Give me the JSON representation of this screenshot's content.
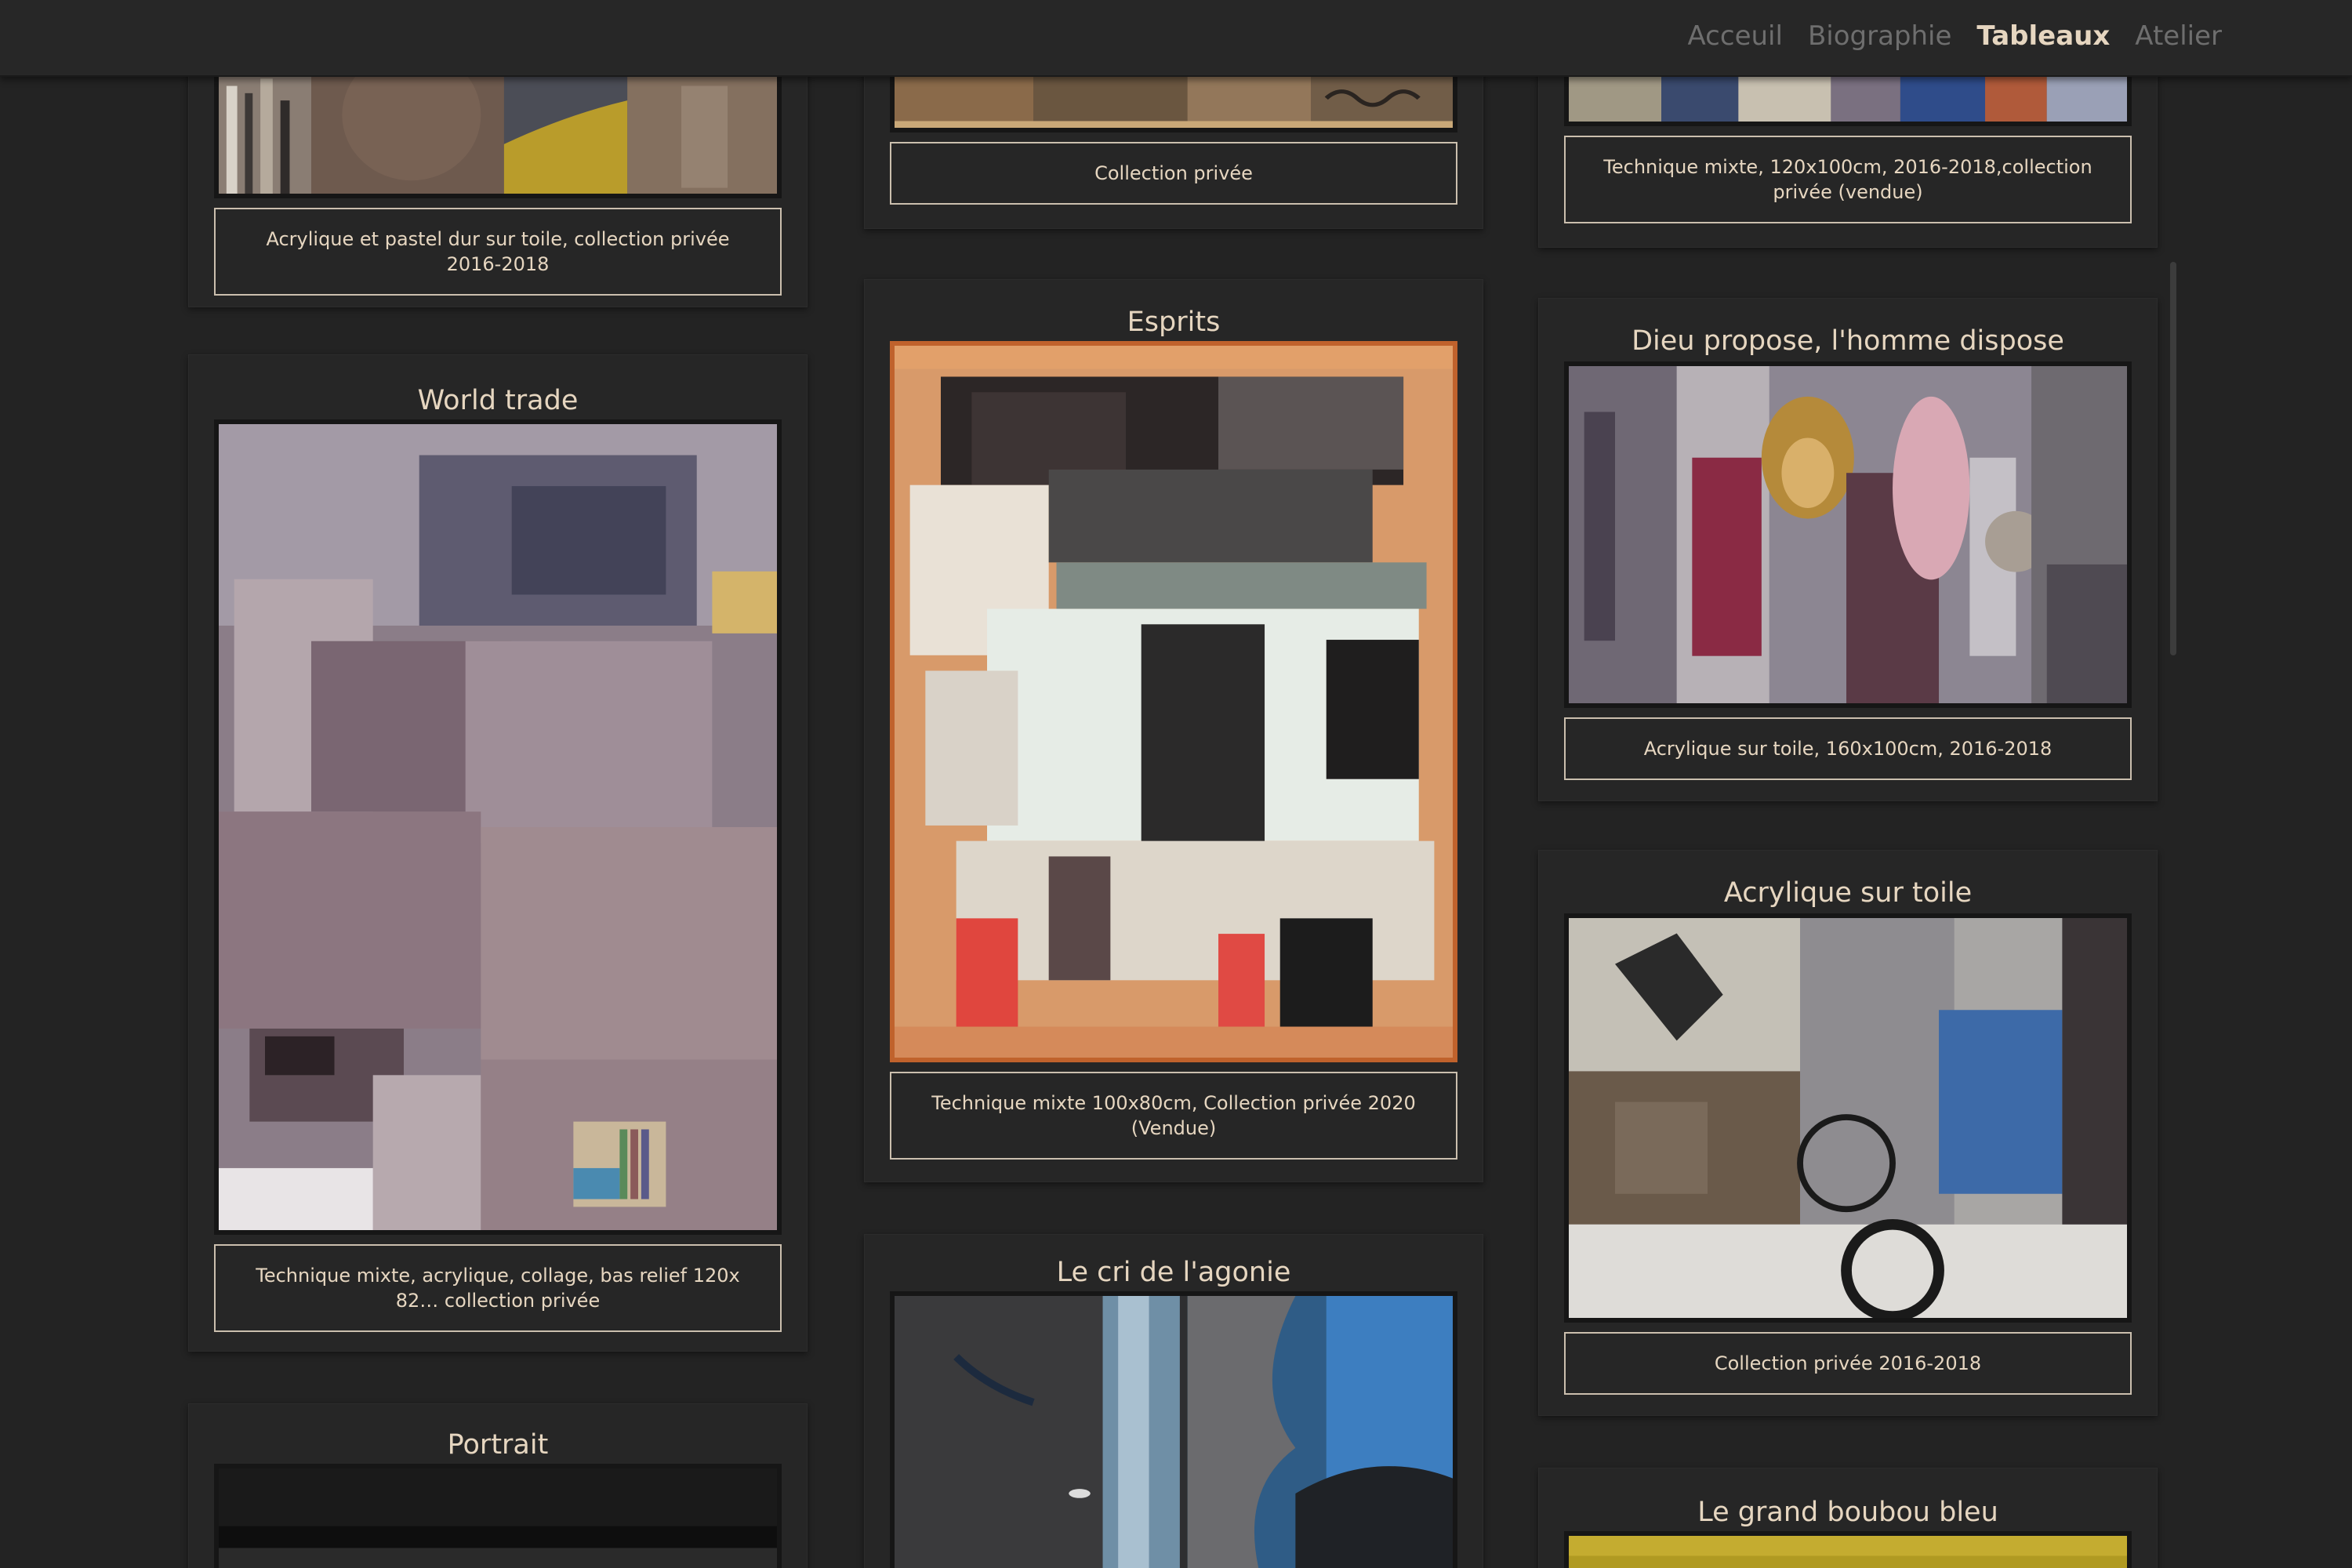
{
  "nav": {
    "items": [
      {
        "label": "Acceuil",
        "active": false
      },
      {
        "label": "Biographie",
        "active": false
      },
      {
        "label": "Tableaux",
        "active": true
      },
      {
        "label": "Atelier",
        "active": false
      }
    ]
  },
  "colors": {
    "background": "#232323",
    "card_background": "#262626",
    "text": "#e6d6c0",
    "nav_inactive": "#6e6e6e",
    "caption_border": "#cbbfae"
  },
  "gallery": {
    "col1": [
      {
        "title": "",
        "caption": "Acrylique et pastel dur sur toile, collection privée 2016-2018"
      },
      {
        "title": "World trade",
        "caption": "Technique mixte, acrylique, collage, bas relief 120x 82… collection privée"
      },
      {
        "title": "Portrait",
        "caption": ""
      }
    ],
    "col2": [
      {
        "title": "",
        "caption": "Collection privée"
      },
      {
        "title": "Esprits",
        "caption": "Technique mixte 100x80cm, Collection privée 2020 (Vendue)"
      },
      {
        "title": "Le cri de l'agonie",
        "caption": ""
      }
    ],
    "col3": [
      {
        "title": "",
        "caption": "Technique mixte, 120x100cm, 2016-2018,collection privée (vendue)"
      },
      {
        "title": "Dieu propose, l'homme dispose",
        "caption": "Acrylique sur toile, 160x100cm, 2016-2018"
      },
      {
        "title": "Acrylique sur toile",
        "caption": "Collection privée 2016-2018"
      },
      {
        "title": "Le grand boubou bleu",
        "caption": ""
      }
    ]
  }
}
